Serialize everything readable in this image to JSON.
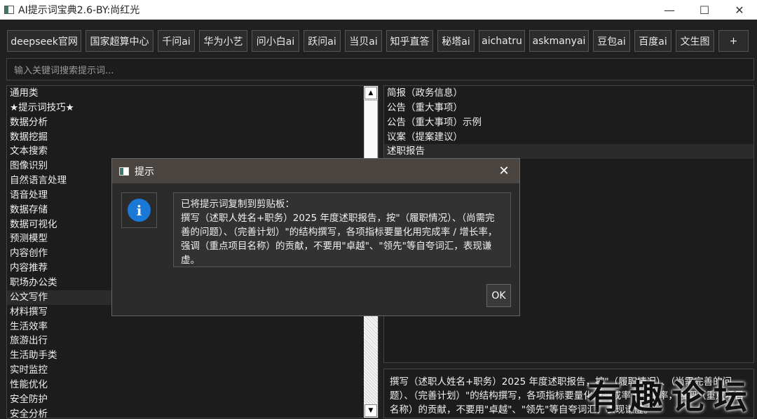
{
  "window": {
    "title": "AI提示词宝典2.6-BY:尚红光",
    "minimize_glyph": "—",
    "maximize_glyph": "☐",
    "close_glyph": "✕"
  },
  "toolbar": {
    "buttons": [
      {
        "label": "deepseek官网"
      },
      {
        "label": "国家超算中心"
      },
      {
        "label": "千问ai"
      },
      {
        "label": "华为小艺"
      },
      {
        "label": "问小白ai"
      },
      {
        "label": "跃问ai"
      },
      {
        "label": "当贝ai"
      },
      {
        "label": "知乎直答"
      },
      {
        "label": "秘塔ai"
      },
      {
        "label": "aichatru"
      },
      {
        "label": "askmanyai"
      },
      {
        "label": "豆包ai"
      },
      {
        "label": "百度ai"
      },
      {
        "label": "文生图"
      },
      {
        "label": "+"
      }
    ]
  },
  "search": {
    "placeholder": "输入关键词搜索提示词..."
  },
  "categories": {
    "items": [
      "通用类",
      "★提示词技巧★",
      "数据分析",
      "数据挖掘",
      "文本搜索",
      "图像识别",
      "自然语言处理",
      "语音处理",
      "数据存储",
      "数据可视化",
      "预测模型",
      "内容创作",
      "内容推荐",
      "职场办公类",
      "公文写作",
      "材料撰写",
      "生活效率",
      "旅游出行",
      "生活助手类",
      "实时监控",
      "性能优化",
      "安全防护",
      "安全分析"
    ],
    "selected_index": 14
  },
  "prompts": {
    "items": [
      "简报（政务信息）",
      "公告（重大事项）",
      "公告（重大事项）示例",
      "议案（提案建议）",
      "述职报告"
    ],
    "selected_index": 4
  },
  "preview": {
    "text": "撰写（述职人姓名+职务）2025 年度述职报告，按\"（履职情况）、（尚需完善的问题）、（完善计划）\"的结构撰写，各项指标要量化用完成率 / 增长率，强调（重点项目名称）的贡献，不要用\"卓越\"、\"领先\"等自夸词汇，表现谦虚。"
  },
  "watermark": {
    "text": "有趣论坛"
  },
  "dialog": {
    "title": "提示",
    "close_glyph": "✕",
    "info_glyph": "i",
    "message_header": "已将提示词复制到剪贴板：",
    "message_body": "撰写（述职人姓名+职务）2025 年度述职报告，按\"（履职情况）、（尚需完善的问题）、（完善计划）\"的结构撰写，各项指标要量化用完成率 / 增长率，强调（重点项目名称）的贡献，不要用\"卓越\"、\"领先\"等自夸词汇，表现谦虚。",
    "ok_label": "OK"
  },
  "colors": {
    "background": "#202020",
    "info_blue": "#1a78d6",
    "dialog_title_bar": "#4a4540"
  }
}
